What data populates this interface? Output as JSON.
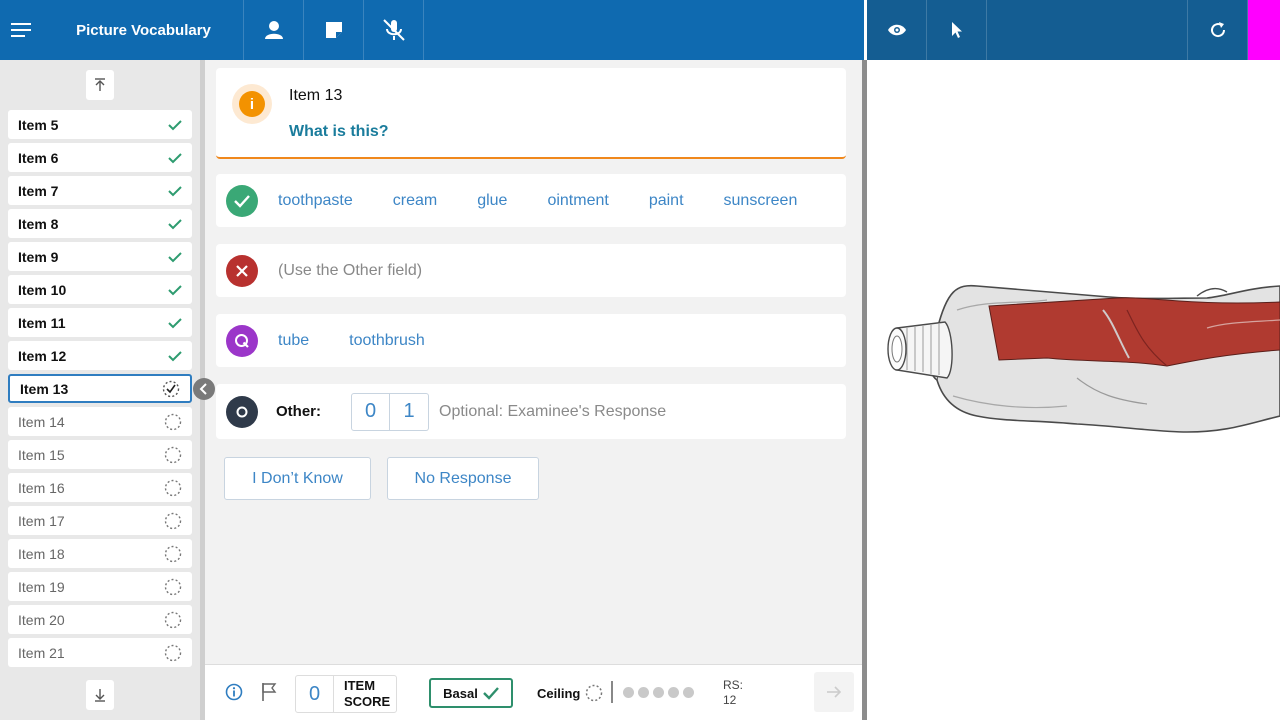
{
  "header": {
    "title": "Picture Vocabulary",
    "icons": [
      "menu-icon",
      "person-icon",
      "note-icon",
      "mic-off-icon"
    ]
  },
  "right_toolbar": {
    "icons": [
      "eye-icon",
      "pointer-icon",
      "refresh-icon"
    ],
    "accent_color": "#ff00ff"
  },
  "sidebar": {
    "items": [
      {
        "label": "Item 5",
        "status": "done"
      },
      {
        "label": "Item 6",
        "status": "done"
      },
      {
        "label": "Item 7",
        "status": "done"
      },
      {
        "label": "Item 8",
        "status": "done"
      },
      {
        "label": "Item 9",
        "status": "done"
      },
      {
        "label": "Item 10",
        "status": "done"
      },
      {
        "label": "Item 11",
        "status": "done"
      },
      {
        "label": "Item 12",
        "status": "done"
      },
      {
        "label": "Item 13",
        "status": "current"
      },
      {
        "label": "Item 14",
        "status": "pending"
      },
      {
        "label": "Item 15",
        "status": "pending"
      },
      {
        "label": "Item 16",
        "status": "pending"
      },
      {
        "label": "Item 17",
        "status": "pending"
      },
      {
        "label": "Item 18",
        "status": "pending"
      },
      {
        "label": "Item 19",
        "status": "pending"
      },
      {
        "label": "Item 20",
        "status": "pending"
      },
      {
        "label": "Item 21",
        "status": "pending"
      }
    ]
  },
  "question": {
    "item_label": "Item 13",
    "prompt": "What is this?"
  },
  "responses": {
    "correct": [
      "toothpaste",
      "cream",
      "glue",
      "ointment",
      "paint",
      "sunscreen"
    ],
    "incorrect_placeholder": "(Use the Other field)",
    "query": [
      "tube",
      "toothbrush"
    ],
    "other": {
      "label": "Other:",
      "score_options": [
        "0",
        "1"
      ],
      "placeholder": "Optional: Examinee's Response"
    }
  },
  "buttons": {
    "dont_know": "I Don’t Know",
    "no_response": "No Response"
  },
  "footer": {
    "item_score_value": "0",
    "item_score_label_1": "ITEM",
    "item_score_label_2": "SCORE",
    "basal_label": "Basal",
    "ceiling_label": "Ceiling",
    "rs_label": "RS:",
    "rs_value": "12"
  },
  "colors": {
    "header_blue": "#0f6ab0",
    "correct_green": "#3aa876",
    "incorrect_red": "#b8312f",
    "query_purple": "#9b36c9",
    "other_dark": "#2f3a4a",
    "info_orange": "#f39200",
    "link_blue": "#3d86c6"
  }
}
